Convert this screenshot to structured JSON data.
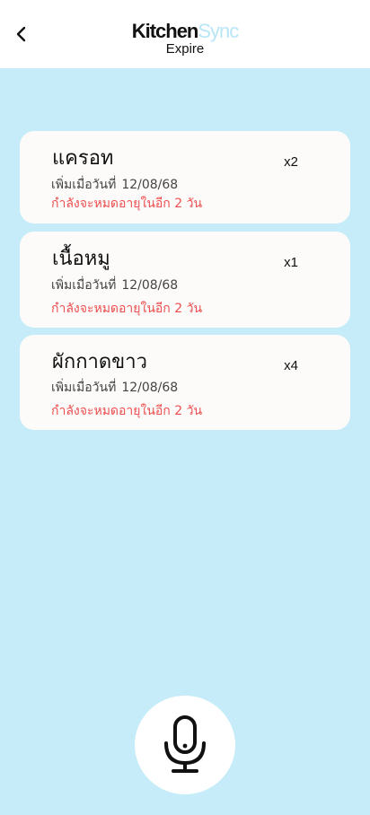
{
  "header": {
    "brand_part1": "Kitchen",
    "brand_part2": "Sync",
    "subtitle": "Expire",
    "back_icon": "chevron-left-icon"
  },
  "items": [
    {
      "name": "แครอท",
      "quantity": "x2",
      "added_label": "เพิ่มเมื่อวันที่",
      "added_date": "12/08/68",
      "expire_text": "กำลังจะหมดอายุในอีก 2 วัน"
    },
    {
      "name": "เนื้อหมู",
      "quantity": "x1",
      "added_label": "เพิ่มเมื่อวันที่",
      "added_date": "12/08/68",
      "expire_text": "กำลังจะหมดอายุในอีก 2 วัน"
    },
    {
      "name": "ผักกาดขาว",
      "quantity": "x4",
      "added_label": "เพิ่มเมื่อวันที่",
      "added_date": "12/08/68",
      "expire_text": "กำลังจะหมดอายุในอีก 2 วัน"
    }
  ],
  "mic": {
    "icon": "microphone-icon"
  },
  "colors": {
    "background": "#c5ecf8",
    "brand_accent": "#b9e6f6",
    "expire_text": "#ec4f4f",
    "card": "#fcfbfa"
  }
}
